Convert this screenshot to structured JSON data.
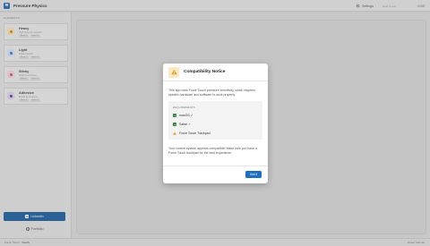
{
  "app": {
    "title": "Pressure Physics"
  },
  "header": {
    "settings_label": "Settings",
    "status_text": "Hold to test",
    "pressure_value": "0.00"
  },
  "sidebar": {
    "section_label": "ELEMENTS",
    "items": [
      {
        "name": "Heavy",
        "description": "High pressure required",
        "chips": [
          "Mass: 5",
          "Force: 4"
        ],
        "icon": "heavy-element-icon",
        "color": "#f2b64c"
      },
      {
        "name": "Light",
        "description": "Floats upward",
        "chips": [
          "Mass: 1",
          "Force: 1"
        ],
        "icon": "light-element-icon",
        "color": "#5b8fd6"
      },
      {
        "name": "Sticky",
        "description": "Sticks to surfaces",
        "chips": [
          "Mass: 2",
          "Force: 3"
        ],
        "icon": "sticky-element-icon",
        "color": "#e08a9d"
      },
      {
        "name": "Adhesive",
        "description": "Bonds on pressure",
        "chips": [
          "Mass: 3",
          "Force: 2"
        ],
        "icon": "adhesive-element-icon",
        "color": "#7a5bb8"
      }
    ],
    "linkedin_label": "LinkedIn",
    "portfolio_label": "Portfolio"
  },
  "footer": {
    "left_label": "Force Touch",
    "left_value": "Ready",
    "right_label": "Reset Canvas"
  },
  "dialog": {
    "title": "Compatibility Notice",
    "text": "This app uses Force Touch pressure sensitivity, which requires specific hardware and software to work properly.",
    "requirements_label": "REQUIREMENTS",
    "requirements": [
      {
        "label": "macOS ✓",
        "status": "ok"
      },
      {
        "label": "Safari ✓",
        "status": "ok"
      },
      {
        "label": "Force Touch Trackpad",
        "status": "warning"
      }
    ],
    "note": "Your current system appears compatible! Make sure you have a Force Touch trackpad for the best experience.",
    "button_label": "Got it"
  },
  "colors": {
    "accent": "#1f6fc0",
    "success": "#2e8b3a",
    "warning": "#e0a030"
  }
}
